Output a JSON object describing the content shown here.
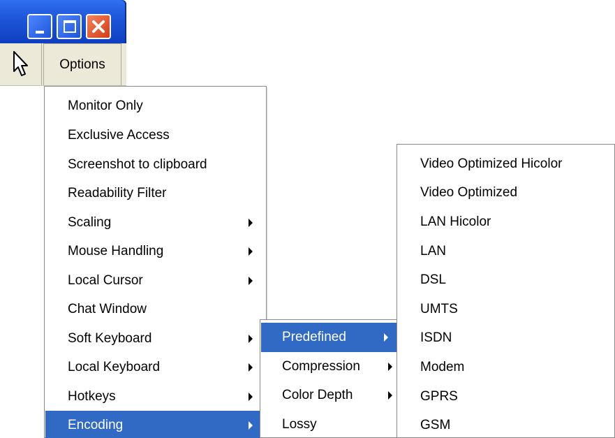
{
  "menubar": {
    "options_label": "Options"
  },
  "main_menu": {
    "items": [
      {
        "label": "Monitor Only",
        "submenu": false
      },
      {
        "label": "Exclusive Access",
        "submenu": false
      },
      {
        "label": "Screenshot to clipboard",
        "submenu": false
      },
      {
        "label": "Readability Filter",
        "submenu": false
      },
      {
        "label": "Scaling",
        "submenu": true
      },
      {
        "label": "Mouse Handling",
        "submenu": true
      },
      {
        "label": "Local Cursor",
        "submenu": true
      },
      {
        "label": "Chat Window",
        "submenu": false
      },
      {
        "label": "Soft Keyboard",
        "submenu": true
      },
      {
        "label": "Local Keyboard",
        "submenu": true
      },
      {
        "label": "Hotkeys",
        "submenu": true
      },
      {
        "label": "Encoding",
        "submenu": true,
        "selected": true
      }
    ]
  },
  "encoding_menu": {
    "items": [
      {
        "label": "Predefined",
        "submenu": true,
        "selected": true
      },
      {
        "label": "Compression",
        "submenu": true
      },
      {
        "label": "Color Depth",
        "submenu": true
      },
      {
        "label": "Lossy",
        "submenu": false
      }
    ]
  },
  "predefined_menu": {
    "items": [
      {
        "label": "Video Optimized Hicolor"
      },
      {
        "label": "Video Optimized"
      },
      {
        "label": "LAN Hicolor"
      },
      {
        "label": "LAN"
      },
      {
        "label": "DSL"
      },
      {
        "label": "UMTS"
      },
      {
        "label": "ISDN"
      },
      {
        "label": "Modem"
      },
      {
        "label": "GPRS"
      },
      {
        "label": "GSM"
      }
    ]
  },
  "colors": {
    "selection": "#316ac5",
    "titlebar": "#1d55d8",
    "close_button": "#d43b16",
    "menubar": "#ece9d8"
  },
  "icons": {
    "cursor": "mouse-pointer-icon",
    "minimize": "minimize-icon",
    "maximize": "maximize-icon",
    "close": "close-icon",
    "submenu": "submenu-arrow-icon"
  }
}
